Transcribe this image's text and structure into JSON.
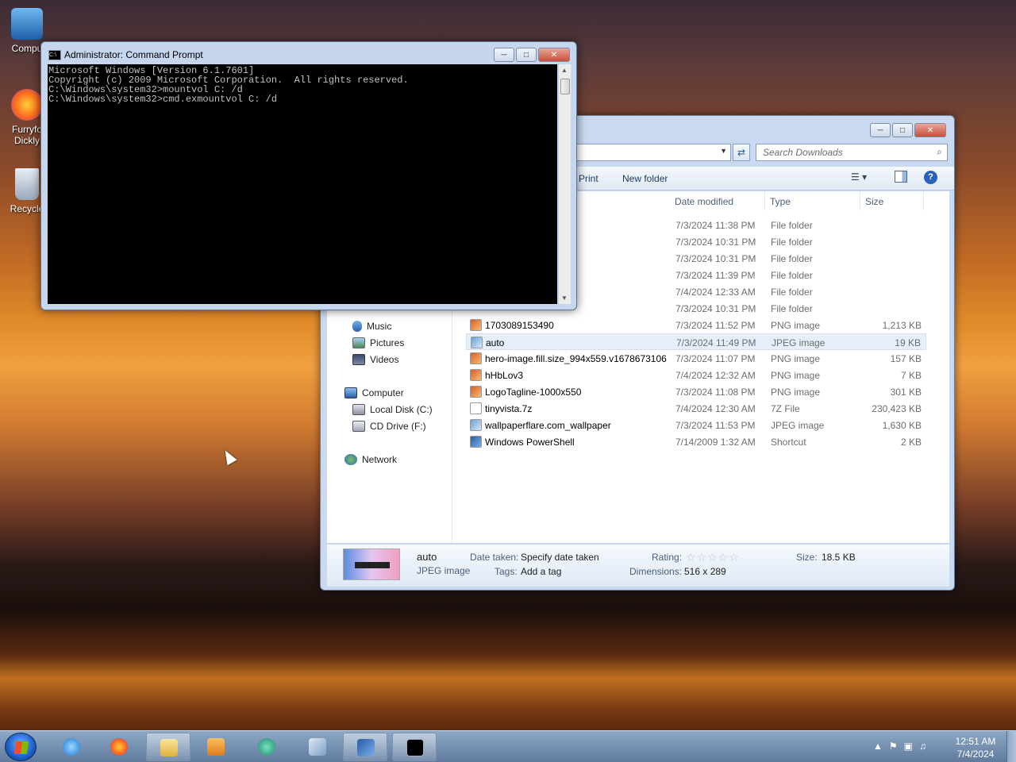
{
  "desktop": {
    "icons": [
      {
        "label": "Compu",
        "name": "computer-icon"
      },
      {
        "label": "Furryfo Dickly",
        "name": "firefox-icon"
      },
      {
        "label": "Recycle",
        "name": "recycle-bin-icon"
      }
    ]
  },
  "cmd_window": {
    "title": "Administrator: Command Prompt",
    "lines": [
      "Microsoft Windows [Version 6.1.7601]",
      "Copyright (c) 2009 Microsoft Corporation.  All rights reserved.",
      "",
      "C:\\Windows\\system32>mountvol C: /d",
      "",
      "",
      "C:\\Windows\\system32>cmd.exmountvol C: /d"
    ]
  },
  "explorer": {
    "search_placeholder": "Search Downloads",
    "toolbar": {
      "print": "Print",
      "new_folder": "New folder"
    },
    "columns": {
      "date": "Date modified",
      "type": "Type",
      "size": "Size"
    },
    "nav": {
      "music": "Music",
      "pictures": "Pictures",
      "videos": "Videos",
      "computer": "Computer",
      "local_disk": "Local Disk (C:)",
      "cd_drive": "CD Drive (F:)",
      "network": "Network"
    },
    "folders": [
      {
        "date": "7/3/2024 11:38 PM",
        "type": "File folder"
      },
      {
        "date": "7/3/2024 10:31 PM",
        "type": "File folder"
      },
      {
        "date": "7/3/2024 10:31 PM",
        "type": "File folder"
      },
      {
        "date": "7/3/2024 11:39 PM",
        "type": "File folder"
      },
      {
        "date": "7/4/2024 12:33 AM",
        "type": "File folder"
      },
      {
        "date": "7/3/2024 10:31 PM",
        "type": "File folder"
      }
    ],
    "files": [
      {
        "name": "1703089153490",
        "date": "7/3/2024 11:52 PM",
        "type": "PNG image",
        "size": "1,213 KB"
      },
      {
        "name": "auto",
        "date": "7/3/2024 11:49 PM",
        "type": "JPEG image",
        "size": "19 KB"
      },
      {
        "name": "hero-image.fill.size_994x559.v1678673106",
        "date": "7/3/2024 11:07 PM",
        "type": "PNG image",
        "size": "157 KB"
      },
      {
        "name": "hHbLov3",
        "date": "7/4/2024 12:32 AM",
        "type": "PNG image",
        "size": "7 KB"
      },
      {
        "name": "LogoTagline-1000x550",
        "date": "7/3/2024 11:08 PM",
        "type": "PNG image",
        "size": "301 KB"
      },
      {
        "name": "tinyvista.7z",
        "date": "7/4/2024 12:30 AM",
        "type": "7Z File",
        "size": "230,423 KB"
      },
      {
        "name": "wallpaperflare.com_wallpaper",
        "date": "7/3/2024 11:53 PM",
        "type": "JPEG image",
        "size": "1,630 KB"
      },
      {
        "name": "Windows PowerShell",
        "date": "7/14/2009 1:32 AM",
        "type": "Shortcut",
        "size": "2 KB"
      }
    ],
    "details": {
      "name": "auto",
      "kind": "JPEG image",
      "date_taken_label": "Date taken:",
      "date_taken": "Specify date taken",
      "tags_label": "Tags:",
      "tags": "Add a tag",
      "rating_label": "Rating:",
      "dimensions_label": "Dimensions:",
      "dimensions": "516 x 289",
      "size_label": "Size:",
      "size": "18.5 KB"
    }
  },
  "taskbar": {
    "time": "12:51 AM",
    "date": "7/4/2024"
  }
}
